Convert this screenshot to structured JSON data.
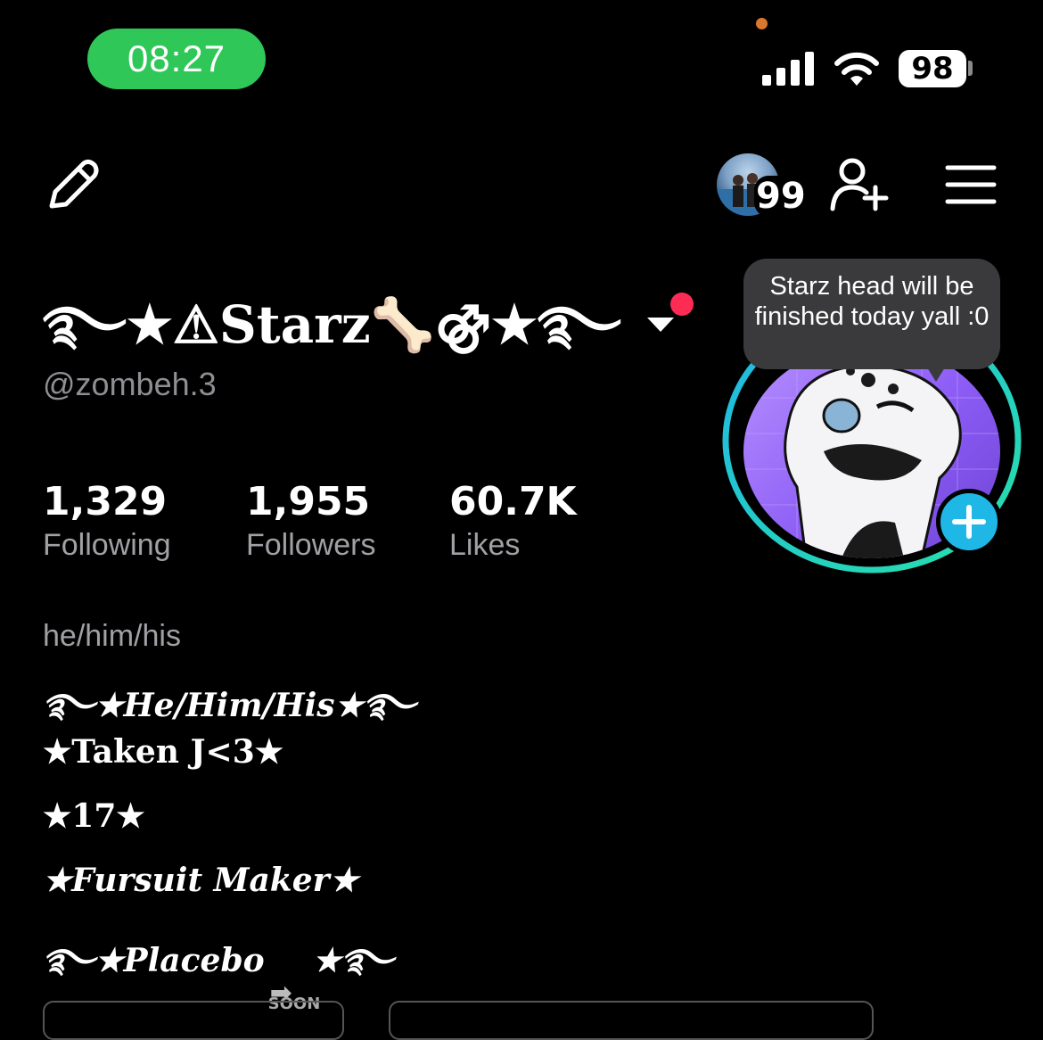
{
  "status_bar": {
    "time": "08:27",
    "battery": "98"
  },
  "toolbar": {
    "friends_count": "99"
  },
  "profile": {
    "display_name": "࿐★⚠Starz🦴⚣★࿐",
    "username": "@zombeh.3",
    "stats": [
      {
        "value": "1,329",
        "label": "Following"
      },
      {
        "value": "1,955",
        "label": "Followers"
      },
      {
        "value": "60.7K",
        "label": "Likes"
      }
    ],
    "note_bubble": "Starz head will be finished today yall :0"
  },
  "bio": {
    "pronouns": "he/him/his",
    "lines": [
      "࿐★He/Him/His★࿐",
      "★Taken J<3★",
      "★17★",
      "★Fursuit Maker★"
    ],
    "last_line_prefix": "࿐★Placebo",
    "soon_label": "SOON",
    "last_line_suffix": "★࿐"
  },
  "colors": {
    "time_pill": "#30c759",
    "notification_dot": "#fe2c55",
    "add_story": "#1fb8e6",
    "ring_start": "#1fb8e6",
    "ring_end": "#28e0a8"
  },
  "icons": [
    "edit-icon",
    "add-friend-icon",
    "menu-icon",
    "signal-icon",
    "wifi-icon",
    "plus-icon",
    "chevron-down-icon"
  ]
}
